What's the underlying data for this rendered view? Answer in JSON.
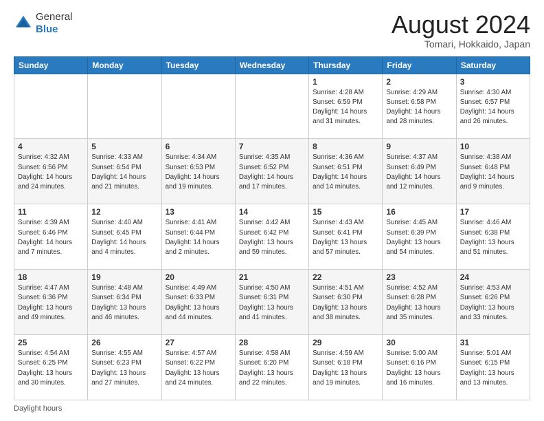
{
  "logo": {
    "general": "General",
    "blue": "Blue"
  },
  "title": "August 2024",
  "subtitle": "Tomari, Hokkaido, Japan",
  "days_of_week": [
    "Sunday",
    "Monday",
    "Tuesday",
    "Wednesday",
    "Thursday",
    "Friday",
    "Saturday"
  ],
  "footer": "Daylight hours",
  "weeks": [
    [
      {
        "day": "",
        "info": ""
      },
      {
        "day": "",
        "info": ""
      },
      {
        "day": "",
        "info": ""
      },
      {
        "day": "",
        "info": ""
      },
      {
        "day": "1",
        "info": "Sunrise: 4:28 AM\nSunset: 6:59 PM\nDaylight: 14 hours\nand 31 minutes."
      },
      {
        "day": "2",
        "info": "Sunrise: 4:29 AM\nSunset: 6:58 PM\nDaylight: 14 hours\nand 28 minutes."
      },
      {
        "day": "3",
        "info": "Sunrise: 4:30 AM\nSunset: 6:57 PM\nDaylight: 14 hours\nand 26 minutes."
      }
    ],
    [
      {
        "day": "4",
        "info": "Sunrise: 4:32 AM\nSunset: 6:56 PM\nDaylight: 14 hours\nand 24 minutes."
      },
      {
        "day": "5",
        "info": "Sunrise: 4:33 AM\nSunset: 6:54 PM\nDaylight: 14 hours\nand 21 minutes."
      },
      {
        "day": "6",
        "info": "Sunrise: 4:34 AM\nSunset: 6:53 PM\nDaylight: 14 hours\nand 19 minutes."
      },
      {
        "day": "7",
        "info": "Sunrise: 4:35 AM\nSunset: 6:52 PM\nDaylight: 14 hours\nand 17 minutes."
      },
      {
        "day": "8",
        "info": "Sunrise: 4:36 AM\nSunset: 6:51 PM\nDaylight: 14 hours\nand 14 minutes."
      },
      {
        "day": "9",
        "info": "Sunrise: 4:37 AM\nSunset: 6:49 PM\nDaylight: 14 hours\nand 12 minutes."
      },
      {
        "day": "10",
        "info": "Sunrise: 4:38 AM\nSunset: 6:48 PM\nDaylight: 14 hours\nand 9 minutes."
      }
    ],
    [
      {
        "day": "11",
        "info": "Sunrise: 4:39 AM\nSunset: 6:46 PM\nDaylight: 14 hours\nand 7 minutes."
      },
      {
        "day": "12",
        "info": "Sunrise: 4:40 AM\nSunset: 6:45 PM\nDaylight: 14 hours\nand 4 minutes."
      },
      {
        "day": "13",
        "info": "Sunrise: 4:41 AM\nSunset: 6:44 PM\nDaylight: 14 hours\nand 2 minutes."
      },
      {
        "day": "14",
        "info": "Sunrise: 4:42 AM\nSunset: 6:42 PM\nDaylight: 13 hours\nand 59 minutes."
      },
      {
        "day": "15",
        "info": "Sunrise: 4:43 AM\nSunset: 6:41 PM\nDaylight: 13 hours\nand 57 minutes."
      },
      {
        "day": "16",
        "info": "Sunrise: 4:45 AM\nSunset: 6:39 PM\nDaylight: 13 hours\nand 54 minutes."
      },
      {
        "day": "17",
        "info": "Sunrise: 4:46 AM\nSunset: 6:38 PM\nDaylight: 13 hours\nand 51 minutes."
      }
    ],
    [
      {
        "day": "18",
        "info": "Sunrise: 4:47 AM\nSunset: 6:36 PM\nDaylight: 13 hours\nand 49 minutes."
      },
      {
        "day": "19",
        "info": "Sunrise: 4:48 AM\nSunset: 6:34 PM\nDaylight: 13 hours\nand 46 minutes."
      },
      {
        "day": "20",
        "info": "Sunrise: 4:49 AM\nSunset: 6:33 PM\nDaylight: 13 hours\nand 44 minutes."
      },
      {
        "day": "21",
        "info": "Sunrise: 4:50 AM\nSunset: 6:31 PM\nDaylight: 13 hours\nand 41 minutes."
      },
      {
        "day": "22",
        "info": "Sunrise: 4:51 AM\nSunset: 6:30 PM\nDaylight: 13 hours\nand 38 minutes."
      },
      {
        "day": "23",
        "info": "Sunrise: 4:52 AM\nSunset: 6:28 PM\nDaylight: 13 hours\nand 35 minutes."
      },
      {
        "day": "24",
        "info": "Sunrise: 4:53 AM\nSunset: 6:26 PM\nDaylight: 13 hours\nand 33 minutes."
      }
    ],
    [
      {
        "day": "25",
        "info": "Sunrise: 4:54 AM\nSunset: 6:25 PM\nDaylight: 13 hours\nand 30 minutes."
      },
      {
        "day": "26",
        "info": "Sunrise: 4:55 AM\nSunset: 6:23 PM\nDaylight: 13 hours\nand 27 minutes."
      },
      {
        "day": "27",
        "info": "Sunrise: 4:57 AM\nSunset: 6:22 PM\nDaylight: 13 hours\nand 24 minutes."
      },
      {
        "day": "28",
        "info": "Sunrise: 4:58 AM\nSunset: 6:20 PM\nDaylight: 13 hours\nand 22 minutes."
      },
      {
        "day": "29",
        "info": "Sunrise: 4:59 AM\nSunset: 6:18 PM\nDaylight: 13 hours\nand 19 minutes."
      },
      {
        "day": "30",
        "info": "Sunrise: 5:00 AM\nSunset: 6:16 PM\nDaylight: 13 hours\nand 16 minutes."
      },
      {
        "day": "31",
        "info": "Sunrise: 5:01 AM\nSunset: 6:15 PM\nDaylight: 13 hours\nand 13 minutes."
      }
    ]
  ]
}
